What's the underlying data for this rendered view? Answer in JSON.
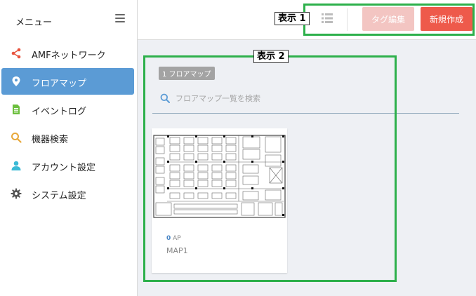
{
  "sidebar": {
    "title": "メニュー",
    "items": [
      {
        "label": "AMFネットワーク",
        "icon": "share-icon",
        "color": "#e8543f",
        "active": false
      },
      {
        "label": "フロアマップ",
        "icon": "map-pin-icon",
        "color": "#ffffff",
        "active": true
      },
      {
        "label": "イベントログ",
        "icon": "document-icon",
        "color": "#6cbf3e",
        "active": false
      },
      {
        "label": "機器検索",
        "icon": "search-icon",
        "color": "#e8a83a",
        "active": false
      },
      {
        "label": "アカウント設定",
        "icon": "user-icon",
        "color": "#3bbad6",
        "active": false
      },
      {
        "label": "システム設定",
        "icon": "gear-icon",
        "color": "#555555",
        "active": false
      }
    ]
  },
  "toolbar": {
    "tag_edit_label": "タグ編集",
    "new_create_label": "新規作成"
  },
  "callouts": {
    "label1": "表示 1",
    "label2": "表示 2",
    "color": "#2db04b"
  },
  "main": {
    "floor_count_badge": "1 フロアマップ",
    "search_placeholder": "フロアマップ一覧を検索",
    "cards": [
      {
        "ap_count": "0",
        "ap_unit": "AP",
        "name": "MAP1"
      }
    ]
  },
  "colors": {
    "accent": "#5b9bd5",
    "primary_button": "#ee5a4b",
    "disabled_button": "#f3c5c2"
  }
}
